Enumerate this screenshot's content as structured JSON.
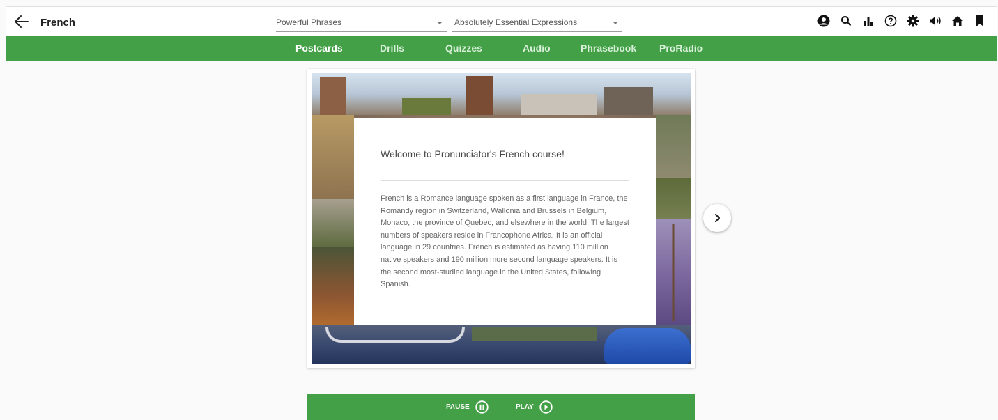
{
  "header": {
    "title": "French",
    "select_1": "Powerful Phrases",
    "select_2": "Absolutely Essential Expressions",
    "icons": [
      "account-icon",
      "search-icon",
      "stats-icon",
      "help-icon",
      "settings-icon",
      "volume-icon",
      "home-icon",
      "bookmark-icon"
    ]
  },
  "nav": {
    "items": [
      "Postcards",
      "Drills",
      "Quizzes",
      "Audio",
      "Phrasebook",
      "ProRadio"
    ],
    "active": "Postcards"
  },
  "postcard": {
    "title": "Welcome to Pronunciator's French course!",
    "body": "French is a Romance language spoken as a first language in France, the Romandy region in Switzerland, Wallonia and Brussels in Belgium, Monaco, the province of Quebec, and elsewhere in the world. The largest numbers of speakers reside in Francophone Africa. It is an official language in 29 countries. French is estimated as having 110 million native speakers and 190 million more second language speakers. It is the second most-studied language in the United States, following Spanish."
  },
  "player": {
    "pause_label": "PAUSE",
    "play_label": "PLAY"
  },
  "colors": {
    "accent": "#43a047",
    "background": "#fafafa"
  }
}
